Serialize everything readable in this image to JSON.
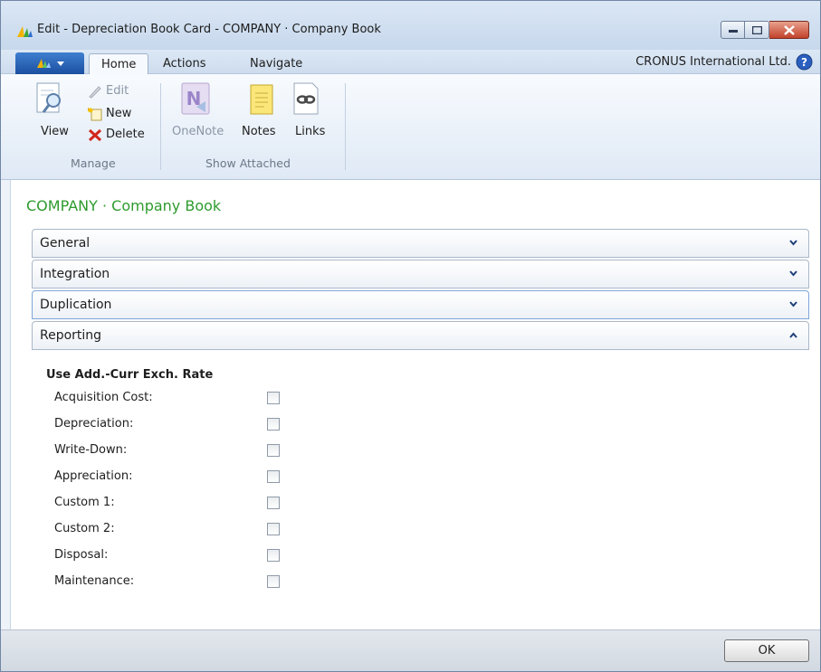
{
  "window": {
    "title": "Edit - Depreciation Book Card - COMPANY · Company Book"
  },
  "menu": {
    "tabs": [
      "Home",
      "Actions",
      "Navigate"
    ],
    "active_tab": "Home",
    "company": "CRONUS International Ltd."
  },
  "ribbon": {
    "manage": {
      "view": "View",
      "edit": "Edit",
      "new": "New",
      "delete": "Delete",
      "group_label": "Manage"
    },
    "show_attached": {
      "onenote": "OneNote",
      "notes": "Notes",
      "links": "Links",
      "group_label": "Show Attached"
    }
  },
  "page": {
    "title": "COMPANY · Company Book",
    "fasttabs": [
      {
        "label": "General",
        "expanded": false
      },
      {
        "label": "Integration",
        "expanded": false
      },
      {
        "label": "Duplication",
        "expanded": false
      },
      {
        "label": "Reporting",
        "expanded": true
      }
    ],
    "reporting": {
      "heading": "Use Add.-Curr Exch. Rate",
      "fields": [
        {
          "label": "Acquisition Cost:",
          "checked": false
        },
        {
          "label": "Depreciation:",
          "checked": false
        },
        {
          "label": "Write-Down:",
          "checked": false
        },
        {
          "label": "Appreciation:",
          "checked": false
        },
        {
          "label": "Custom 1:",
          "checked": false
        },
        {
          "label": "Custom 2:",
          "checked": false
        },
        {
          "label": "Disposal:",
          "checked": false
        },
        {
          "label": "Maintenance:",
          "checked": false
        }
      ]
    }
  },
  "footer": {
    "ok": "OK"
  },
  "colors": {
    "accent_green": "#2e9b2e",
    "close_red": "#c2412a",
    "app_blue": "#1c4fa0"
  }
}
